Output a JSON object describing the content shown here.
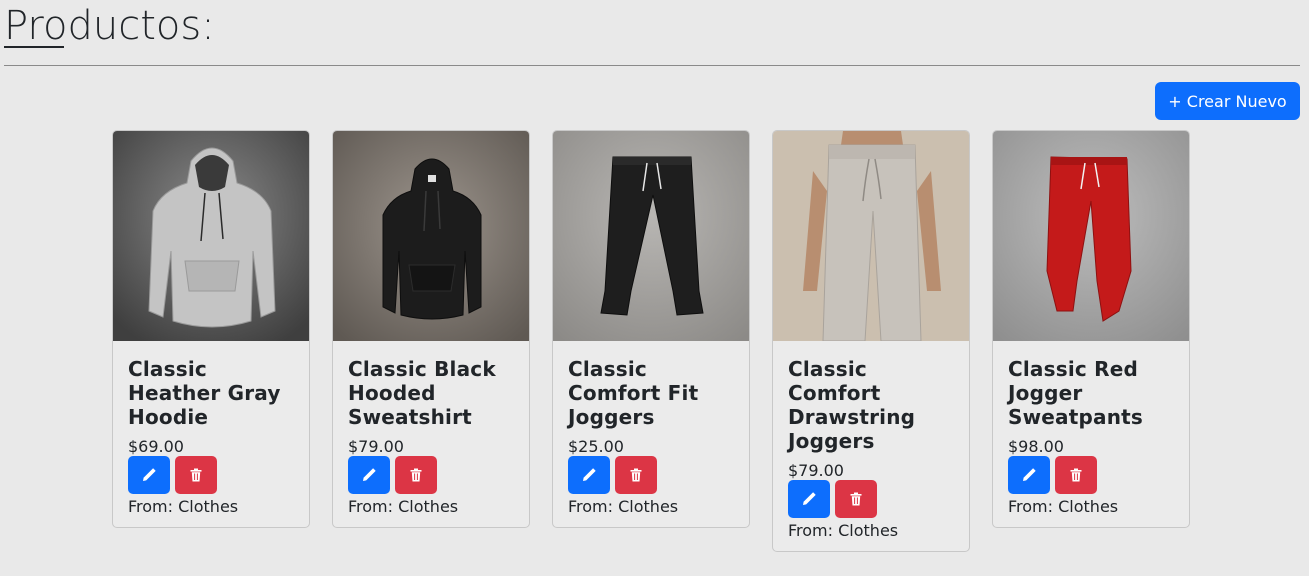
{
  "header": {
    "title": "Productos:",
    "create_label": "+ Crear Nuevo"
  },
  "colors": {
    "primary": "#0d6efd",
    "danger": "#dc3545",
    "background": "#e9e9e9"
  },
  "products": [
    {
      "name": "Classic Heather Gray Hoodie",
      "price": "$69.00",
      "from": "From: Clothes",
      "image": "gray-hoodie",
      "color": "#c9c9c9"
    },
    {
      "name": "Classic Black Hooded Sweatshirt",
      "price": "$79.00",
      "from": "From: Clothes",
      "image": "black-hoodie",
      "color": "#1c1c1c"
    },
    {
      "name": "Classic Comfort Fit Joggers",
      "price": "$25.00",
      "from": "From: Clothes",
      "image": "black-joggers",
      "color": "#1e1e1e"
    },
    {
      "name": "Classic Comfort Drawstring Joggers",
      "price": "$79.00",
      "from": "From: Clothes",
      "image": "gray-joggers-worn",
      "color": "#c7c2bb"
    },
    {
      "name": "Classic Red Jogger Sweatpants",
      "price": "$98.00",
      "from": "From: Clothes",
      "image": "red-joggers",
      "color": "#c41a1a"
    }
  ],
  "icons": {
    "edit": "pencil-icon",
    "delete": "trash-icon"
  }
}
